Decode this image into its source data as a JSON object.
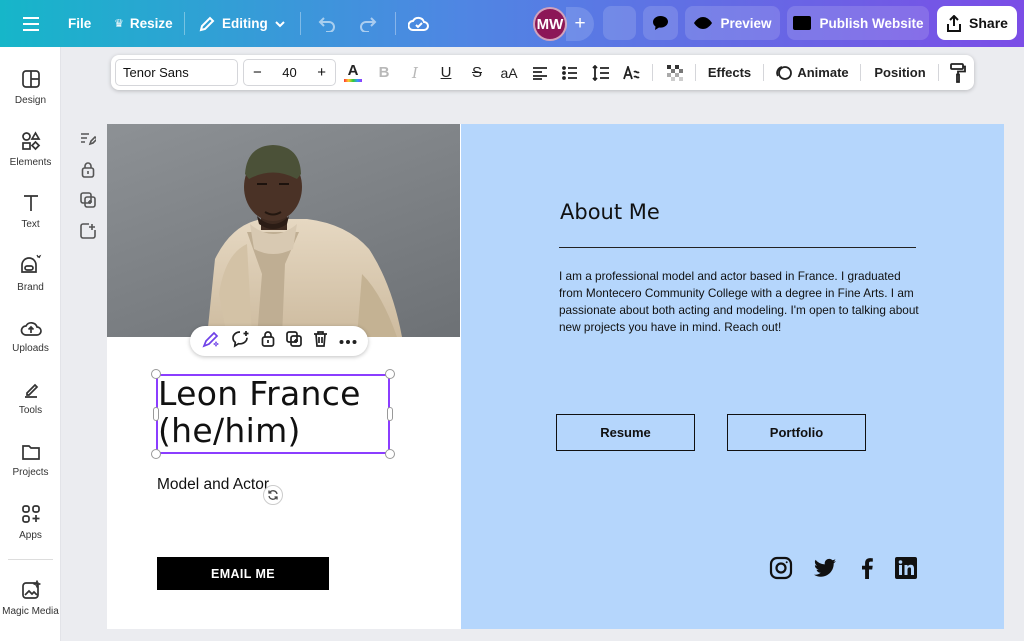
{
  "topbar": {
    "file": "File",
    "resize": "Resize",
    "editing": "Editing",
    "avatar_initials": "MW",
    "add": "+",
    "preview": "Preview",
    "publish": "Publish Website",
    "share": "Share"
  },
  "sidebar": {
    "items": [
      {
        "label": "Design",
        "icon": "design-icon"
      },
      {
        "label": "Elements",
        "icon": "elements-icon"
      },
      {
        "label": "Text",
        "icon": "text-icon"
      },
      {
        "label": "Brand",
        "icon": "brand-icon"
      },
      {
        "label": "Uploads",
        "icon": "uploads-icon"
      },
      {
        "label": "Tools",
        "icon": "tools-icon"
      },
      {
        "label": "Projects",
        "icon": "projects-icon"
      },
      {
        "label": "Apps",
        "icon": "apps-icon"
      },
      {
        "label": "Magic Media",
        "icon": "magic-media-icon"
      }
    ]
  },
  "format": {
    "font": "Tenor Sans",
    "minus": "−",
    "size": "40",
    "plus": "+",
    "case": "aA",
    "effects": "Effects",
    "animate": "Animate",
    "position": "Position"
  },
  "canvas": {
    "name": "Leon France\n(he/him)",
    "name_line1": "Leon France",
    "name_line2": "(he/him)",
    "subtitle": "Model and Actor",
    "email_button": "EMAIL ME",
    "about_title": "About Me",
    "bio": "I am a professional model and actor based in France. I graduated from Montecero Community College with a degree in Fine Arts. I am passionate about both acting and modeling. I'm open to talking about new projects you have in mind. Reach out!",
    "resume": "Resume",
    "portfolio": "Portfolio",
    "social": [
      "instagram-icon",
      "twitter-icon",
      "facebook-icon",
      "linkedin-icon"
    ]
  },
  "colors": {
    "right_panel": "#b5d6fc",
    "selection": "#8b3dff",
    "avatar": "#8c1757"
  }
}
